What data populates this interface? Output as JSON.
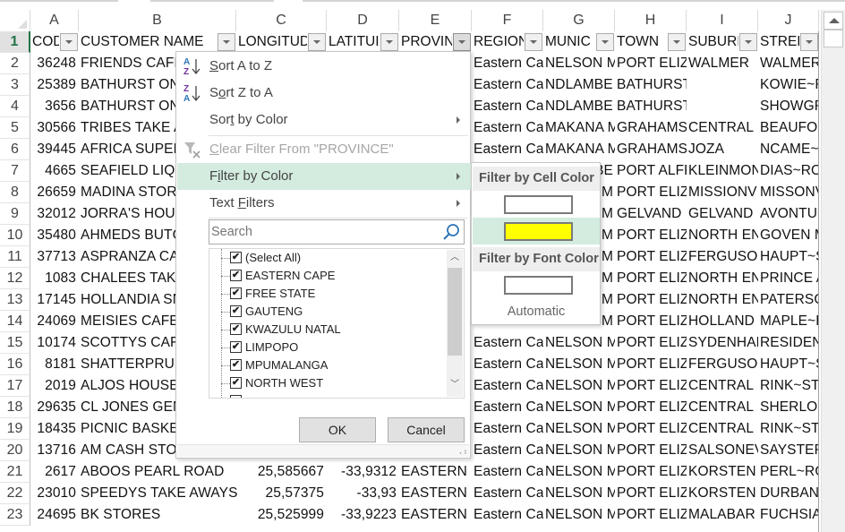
{
  "columns": [
    "A",
    "B",
    "C",
    "D",
    "E",
    "F",
    "G",
    "H",
    "I",
    "J"
  ],
  "headers": [
    "COD",
    "CUSTOMER NAME",
    "LONGITUD",
    "LATITUI",
    "PROVIN",
    "REGION",
    "MUNIC",
    "TOWN",
    "SUBURI",
    "STREET"
  ],
  "row_numbers": [
    "1",
    "2",
    "3",
    "4",
    "5",
    "6",
    "7",
    "8",
    "9",
    "10",
    "11",
    "12",
    "13",
    "14",
    "15",
    "16",
    "17",
    "18",
    "19",
    "20",
    "21",
    "22",
    "23"
  ],
  "rows": [
    {
      "code": "36248",
      "name": "FRIENDS CAFE",
      "lon": "",
      "lat": "",
      "prov": "",
      "region": "Eastern Ca",
      "munic": "NELSON M",
      "town": "PORT ELIZ",
      "suburb": "WALMER",
      "street": "WALMER"
    },
    {
      "code": "25389",
      "name": "BATHURST ON",
      "lon": "",
      "lat": "",
      "prov": "",
      "region": "Eastern Ca",
      "munic": "NDLAMBE",
      "town": "BATHURST",
      "suburb": "",
      "street": "KOWIE~R"
    },
    {
      "code": "3656",
      "name": "BATHURST ON",
      "lon": "",
      "lat": "",
      "prov": "",
      "region": "Eastern Ca",
      "munic": "NDLAMBE",
      "town": "BATHURST",
      "suburb": "",
      "street": "SHOWGR"
    },
    {
      "code": "30566",
      "name": "TRIBES TAKE A",
      "lon": "",
      "lat": "",
      "prov": "",
      "region": "Eastern Ca",
      "munic": "MAKANA M",
      "town": "GRAHAMS",
      "suburb": "CENTRAL",
      "street": "BEAUFOR"
    },
    {
      "code": "39445",
      "name": "AFRICA SUPER",
      "lon": "",
      "lat": "",
      "prov": "",
      "region": "Eastern Ca",
      "munic": "MAKANA M",
      "town": "GRAHAMS",
      "suburb": "JOZA",
      "street": "NCAME~S"
    },
    {
      "code": "4665",
      "name": "SEAFIELD LIQU",
      "lon": "",
      "lat": "",
      "prov": "",
      "region": "",
      "munic": "BE",
      "town": "PORT ALFF",
      "suburb": "KLEINMON",
      "street": "DIAS~ROA"
    },
    {
      "code": "26659",
      "name": "MADINA STOR",
      "lon": "",
      "lat": "",
      "prov": "",
      "region": "",
      "munic": "M",
      "town": "PORT ELIZ",
      "suburb": "MISSIONV",
      "street": "MISSONV"
    },
    {
      "code": "32012",
      "name": "JORRA'S HOUS",
      "lon": "",
      "lat": "",
      "prov": "",
      "region": "",
      "munic": "M",
      "town": "GELVAND",
      "suburb": "GELVAND",
      "street": "AVONTU"
    },
    {
      "code": "35480",
      "name": "AHMEDS BUTC",
      "lon": "",
      "lat": "",
      "prov": "",
      "region": "",
      "munic": "M",
      "town": "PORT ELIZ",
      "suburb": "NORTH EN",
      "street": "GOVEN M"
    },
    {
      "code": "37713",
      "name": "ASPRANZA CAI",
      "lon": "",
      "lat": "",
      "prov": "",
      "region": "",
      "munic": "M",
      "town": "PORT ELIZ",
      "suburb": "FERGUSON",
      "street": "HAUPT~S"
    },
    {
      "code": "1083",
      "name": "CHALEES TAKE",
      "lon": "",
      "lat": "",
      "prov": "",
      "region": "",
      "munic": "M",
      "town": "PORT ELIZ",
      "suburb": "NORTH EN",
      "street": "PRINCE A"
    },
    {
      "code": "17145",
      "name": "HOLLANDIA SN",
      "lon": "",
      "lat": "",
      "prov": "",
      "region": "",
      "munic": "M",
      "town": "PORT ELIZ",
      "suburb": "NORTH EN",
      "street": "PATERSO"
    },
    {
      "code": "24069",
      "name": "MEISIES CAFE",
      "lon": "",
      "lat": "",
      "prov": "",
      "region": "",
      "munic": "M",
      "town": "PORT ELIZ",
      "suburb": "HOLLAND",
      "street": "MAPLE~R"
    },
    {
      "code": "10174",
      "name": "SCOTTYS CAFE",
      "lon": "",
      "lat": "",
      "prov": "",
      "region": "Eastern Ca",
      "munic": "NELSON M",
      "town": "PORT ELIZ",
      "suburb": "SYDENHAM",
      "street": "RESIDENT"
    },
    {
      "code": "8181",
      "name": "SHATTERPRUF",
      "lon": "",
      "lat": "",
      "prov": "",
      "region": "Eastern Ca",
      "munic": "NELSON M",
      "town": "PORT ELIZ",
      "suburb": "FERGUSON",
      "street": "HAUPT~S"
    },
    {
      "code": "2019",
      "name": "ALJOS HOUSEV",
      "lon": "",
      "lat": "",
      "prov": "",
      "region": "Eastern Ca",
      "munic": "NELSON M",
      "town": "PORT ELIZ",
      "suburb": "CENTRAL",
      "street": "RINK~STF"
    },
    {
      "code": "29635",
      "name": "CL JONES GEN",
      "lon": "",
      "lat": "",
      "prov": "",
      "region": "Eastern Ca",
      "munic": "NELSON M",
      "town": "PORT ELIZ",
      "suburb": "CENTRAL",
      "street": "SHERLOC"
    },
    {
      "code": "18435",
      "name": "PICNIC BASKET",
      "lon": "",
      "lat": "",
      "prov": "",
      "region": "Eastern Ca",
      "munic": "NELSON M",
      "town": "PORT ELIZ",
      "suburb": "CENTRAL",
      "street": "RINK~STF"
    },
    {
      "code": "13716",
      "name": "AM CASH STOI",
      "lon": "",
      "lat": "",
      "prov": "",
      "region": "Eastern Ca",
      "munic": "NELSON M",
      "town": "PORT ELIZ",
      "suburb": "SALSONEV",
      "street": "SAYSTER"
    },
    {
      "code": "2617",
      "name": "ABOOS PEARL ROAD",
      "lon": "25,585667",
      "lat": "-33,9312",
      "prov": "EASTERN C",
      "region": "Eastern Ca",
      "munic": "NELSON M",
      "town": "PORT ELIZ",
      "suburb": "KORSTEN",
      "street": "PERL~RO"
    },
    {
      "code": "23010",
      "name": "SPEEDYS TAKE AWAYS",
      "lon": "25,57375",
      "lat": "-33,93",
      "prov": "EASTERN C",
      "region": "Eastern Ca",
      "munic": "NELSON M",
      "town": "PORT ELIZ",
      "suburb": "KORSTEN",
      "street": "DURBAN"
    },
    {
      "code": "24695",
      "name": "BK STORES",
      "lon": "25,525999",
      "lat": "-33,9223",
      "prov": "EASTERN C",
      "region": "Eastern Ca",
      "munic": "NELSON M",
      "town": "PORT ELIZ",
      "suburb": "MALABAR",
      "street": "FUCHSIA"
    }
  ],
  "filter_menu": {
    "sort_az": {
      "pre": "",
      "ul": "S",
      "post": "ort A to Z"
    },
    "sort_za": {
      "pre": "S",
      "ul": "o",
      "post": "rt Z to A"
    },
    "sort_color": {
      "pre": "Sor",
      "ul": "t",
      "post": " by Color"
    },
    "clear_filter": {
      "pre": "",
      "ul": "C",
      "post": "lear Filter From \"PROVINCE\""
    },
    "filter_color": {
      "pre": "F",
      "ul": "i",
      "post": "lter by Color"
    },
    "text_filters": {
      "pre": "Text ",
      "ul": "F",
      "post": "ilters"
    },
    "search_placeholder": "Search",
    "items": [
      {
        "label": "(Select All)",
        "checked": true
      },
      {
        "label": "EASTERN CAPE",
        "checked": true
      },
      {
        "label": "FREE STATE",
        "checked": true
      },
      {
        "label": "GAUTENG",
        "checked": true
      },
      {
        "label": "KWAZULU NATAL",
        "checked": true
      },
      {
        "label": "LIMPOPO",
        "checked": true
      },
      {
        "label": "MPUMALANGA",
        "checked": true
      },
      {
        "label": "NORTH WEST",
        "checked": true
      }
    ],
    "ok_label": "OK",
    "cancel_label": "Cancel"
  },
  "color_submenu": {
    "cell_color_heading": "Filter by Cell Color",
    "font_color_heading": "Filter by Font Color",
    "automatic_label": "Automatic",
    "cell_colors": [
      "#ffffff",
      "#ffff00"
    ],
    "font_colors": [
      "#ffffff"
    ]
  },
  "colors": {
    "accent": "#217346",
    "hover": "#d3ecdf"
  }
}
